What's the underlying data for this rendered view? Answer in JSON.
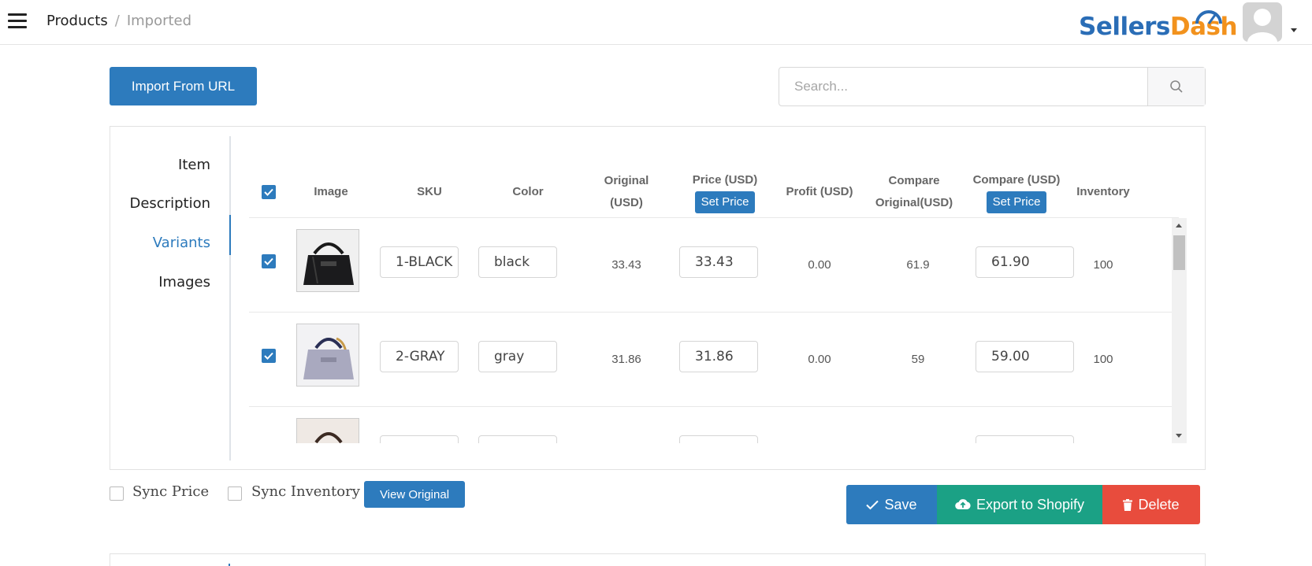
{
  "header": {
    "breadcrumb": [
      "Products",
      "Imported"
    ],
    "breadcrumb_separator": "/",
    "logo": {
      "part1": "Sellers",
      "part2": "Dash"
    },
    "colors": {
      "brand_blue": "#2a6db6",
      "brand_orange": "#f2921d"
    }
  },
  "toolbar": {
    "import_label": "Import From URL",
    "search_placeholder": "Search...",
    "search_icon": "search-icon"
  },
  "sidenav": {
    "items": [
      "Item",
      "Description",
      "Variants",
      "Images"
    ],
    "active": "Variants"
  },
  "table": {
    "columns": {
      "image": "Image",
      "sku": "SKU",
      "color": "Color",
      "original_1": "Original",
      "original_2": "(USD)",
      "price": "Price (USD)",
      "profit": "Profit (USD)",
      "compare_original_1": "Compare",
      "compare_original_2": "Original(USD)",
      "compare": "Compare (USD)",
      "inventory": "Inventory"
    },
    "set_price_label": "Set Price",
    "rows": [
      {
        "sku": "1-BLACK",
        "color": "black",
        "original": "33.43",
        "price": "33.43",
        "profit": "0.00",
        "compare_original": "61.9",
        "compare": "61.90",
        "inventory": "100"
      },
      {
        "sku": "2-GRAY",
        "color": "gray",
        "original": "31.86",
        "price": "31.86",
        "profit": "0.00",
        "compare_original": "59",
        "compare": "59.00",
        "inventory": "100"
      },
      {
        "sku": "",
        "color": "",
        "original": "",
        "price": "",
        "profit": "",
        "compare_original": "",
        "compare": "",
        "inventory": ""
      }
    ]
  },
  "options": {
    "sync_price": "Sync Price",
    "sync_inventory": "Sync Inventory",
    "view_original": "View Original"
  },
  "actions": {
    "save": "Save",
    "export": "Export to Shopify",
    "delete": "Delete",
    "colors": {
      "save": "#2d7bbd",
      "export": "#1ba185",
      "delete": "#e84c3d"
    }
  }
}
